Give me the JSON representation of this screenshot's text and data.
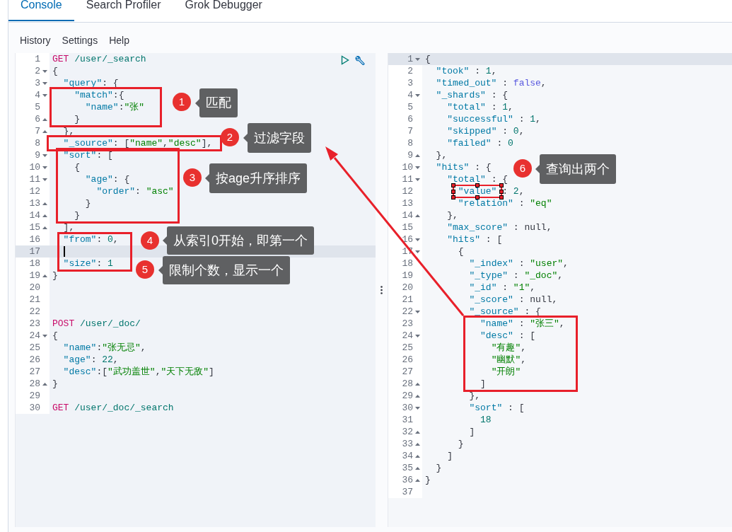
{
  "tabs": [
    {
      "label": "Console",
      "selected": true
    },
    {
      "label": "Search Profiler",
      "selected": false
    },
    {
      "label": "Grok Debugger",
      "selected": false
    }
  ],
  "menu": [
    "History",
    "Settings",
    "Help"
  ],
  "request_editor": {
    "caret_visible": true,
    "lines": [
      {
        "number": "1",
        "kind": "plain",
        "active": false,
        "tokens": [
          {
            "text": "GET",
            "kind": "method"
          },
          {
            "text": " /user/_search",
            "kind": "path"
          }
        ]
      },
      {
        "number": "2",
        "kind": "fold-start",
        "active": false,
        "tokens": [
          {
            "text": "{",
            "kind": "punct"
          }
        ]
      },
      {
        "number": "3",
        "kind": "fold-start",
        "active": false,
        "tokens": [
          {
            "text": "  \"query\"",
            "kind": "key"
          },
          {
            "text": ": {",
            "kind": "punct"
          }
        ]
      },
      {
        "number": "4",
        "kind": "fold-start",
        "active": false,
        "tokens": [
          {
            "text": "    \"match\"",
            "kind": "key"
          },
          {
            "text": ":{",
            "kind": "punct"
          }
        ]
      },
      {
        "number": "5",
        "kind": "plain",
        "active": false,
        "tokens": [
          {
            "text": "      \"name\"",
            "kind": "key"
          },
          {
            "text": ":",
            "kind": "punct"
          },
          {
            "text": "\"张\"",
            "kind": "string"
          }
        ]
      },
      {
        "number": "6",
        "kind": "fold-end",
        "active": false,
        "tokens": [
          {
            "text": "    }",
            "kind": "punct"
          }
        ]
      },
      {
        "number": "7",
        "kind": "fold-end",
        "active": false,
        "tokens": [
          {
            "text": "  },",
            "kind": "punct"
          }
        ]
      },
      {
        "number": "8",
        "kind": "plain",
        "active": false,
        "tokens": [
          {
            "text": "  \"_source\"",
            "kind": "key"
          },
          {
            "text": ": [",
            "kind": "punct"
          },
          {
            "text": "\"name\"",
            "kind": "string"
          },
          {
            "text": ",",
            "kind": "punct"
          },
          {
            "text": "\"desc\"",
            "kind": "string"
          },
          {
            "text": "],",
            "kind": "punct"
          }
        ]
      },
      {
        "number": "9",
        "kind": "fold-start",
        "active": false,
        "tokens": [
          {
            "text": "  \"sort\"",
            "kind": "key"
          },
          {
            "text": ": [",
            "kind": "punct"
          }
        ]
      },
      {
        "number": "10",
        "kind": "fold-start",
        "active": false,
        "tokens": [
          {
            "text": "    {",
            "kind": "punct"
          }
        ]
      },
      {
        "number": "11",
        "kind": "fold-start",
        "active": false,
        "tokens": [
          {
            "text": "      \"age\"",
            "kind": "key"
          },
          {
            "text": ": {",
            "kind": "punct"
          }
        ]
      },
      {
        "number": "12",
        "kind": "plain",
        "active": false,
        "tokens": [
          {
            "text": "        \"order\"",
            "kind": "key"
          },
          {
            "text": ": ",
            "kind": "punct"
          },
          {
            "text": "\"asc\"",
            "kind": "string"
          }
        ]
      },
      {
        "number": "13",
        "kind": "fold-end",
        "active": false,
        "tokens": [
          {
            "text": "      }",
            "kind": "punct"
          }
        ]
      },
      {
        "number": "14",
        "kind": "fold-end",
        "active": false,
        "tokens": [
          {
            "text": "    }",
            "kind": "punct"
          }
        ]
      },
      {
        "number": "15",
        "kind": "fold-end",
        "active": false,
        "tokens": [
          {
            "text": "  ],",
            "kind": "punct"
          }
        ]
      },
      {
        "number": "16",
        "kind": "plain",
        "active": false,
        "tokens": [
          {
            "text": "  \"from\"",
            "kind": "key"
          },
          {
            "text": ": ",
            "kind": "punct"
          },
          {
            "text": "0",
            "kind": "number"
          },
          {
            "text": ",",
            "kind": "punct"
          }
        ]
      },
      {
        "number": "17",
        "kind": "plain",
        "active": true
      },
      {
        "number": "18",
        "kind": "plain",
        "active": false,
        "tokens": [
          {
            "text": "  \"size\"",
            "kind": "key"
          },
          {
            "text": ": ",
            "kind": "punct"
          },
          {
            "text": "1",
            "kind": "number"
          }
        ]
      },
      {
        "number": "19",
        "kind": "fold-end",
        "active": false,
        "tokens": [
          {
            "text": "}",
            "kind": "punct"
          }
        ]
      },
      {
        "number": "20",
        "kind": "plain",
        "active": false
      },
      {
        "number": "21",
        "kind": "plain",
        "active": false
      },
      {
        "number": "22",
        "kind": "plain",
        "active": false
      },
      {
        "number": "23",
        "kind": "plain",
        "active": false,
        "tokens": [
          {
            "text": "POST",
            "kind": "method"
          },
          {
            "text": " /user/_doc/",
            "kind": "path"
          }
        ]
      },
      {
        "number": "24",
        "kind": "fold-start",
        "active": false,
        "tokens": [
          {
            "text": "{",
            "kind": "punct"
          }
        ]
      },
      {
        "number": "25",
        "kind": "plain",
        "active": false,
        "tokens": [
          {
            "text": "  \"name\"",
            "kind": "key"
          },
          {
            "text": ":",
            "kind": "punct"
          },
          {
            "text": "\"张无忌\"",
            "kind": "string"
          },
          {
            "text": ",",
            "kind": "punct"
          }
        ]
      },
      {
        "number": "26",
        "kind": "plain",
        "active": false,
        "tokens": [
          {
            "text": "  \"age\"",
            "kind": "key"
          },
          {
            "text": ": ",
            "kind": "punct"
          },
          {
            "text": "22",
            "kind": "number"
          },
          {
            "text": ",",
            "kind": "punct"
          }
        ]
      },
      {
        "number": "27",
        "kind": "plain",
        "active": false,
        "tokens": [
          {
            "text": "  \"desc\"",
            "kind": "key"
          },
          {
            "text": ":[",
            "kind": "punct"
          },
          {
            "text": "\"武功盖世\"",
            "kind": "string"
          },
          {
            "text": ",",
            "kind": "punct"
          },
          {
            "text": "\"天下无敌\"",
            "kind": "string"
          },
          {
            "text": "]",
            "kind": "punct"
          }
        ]
      },
      {
        "number": "28",
        "kind": "fold-end",
        "active": false,
        "tokens": [
          {
            "text": "}",
            "kind": "punct"
          }
        ]
      },
      {
        "number": "29",
        "kind": "plain",
        "active": false
      },
      {
        "number": "30",
        "kind": "plain",
        "active": false,
        "tokens": [
          {
            "text": "GET",
            "kind": "method"
          },
          {
            "text": " /user/_doc/_search",
            "kind": "path"
          }
        ]
      }
    ]
  },
  "response_editor": {
    "lines": [
      {
        "number": "1",
        "kind": "fold-start",
        "active": true,
        "tokens": [
          {
            "text": "{",
            "kind": "punct"
          }
        ]
      },
      {
        "number": "2",
        "kind": "plain",
        "active": false,
        "tokens": [
          {
            "text": "  \"took\"",
            "kind": "key"
          },
          {
            "text": " : ",
            "kind": "punct"
          },
          {
            "text": "1",
            "kind": "number"
          },
          {
            "text": ",",
            "kind": "punct"
          }
        ]
      },
      {
        "number": "3",
        "kind": "plain",
        "active": false,
        "tokens": [
          {
            "text": "  \"timed_out\"",
            "kind": "key"
          },
          {
            "text": " : ",
            "kind": "punct"
          },
          {
            "text": "false",
            "kind": "literal"
          },
          {
            "text": ",",
            "kind": "punct"
          }
        ]
      },
      {
        "number": "4",
        "kind": "fold-start",
        "active": false,
        "tokens": [
          {
            "text": "  \"_shards\"",
            "kind": "key"
          },
          {
            "text": " : {",
            "kind": "punct"
          }
        ]
      },
      {
        "number": "5",
        "kind": "plain",
        "active": false,
        "tokens": [
          {
            "text": "    \"total\"",
            "kind": "key"
          },
          {
            "text": " : ",
            "kind": "punct"
          },
          {
            "text": "1",
            "kind": "number"
          },
          {
            "text": ",",
            "kind": "punct"
          }
        ]
      },
      {
        "number": "6",
        "kind": "plain",
        "active": false,
        "tokens": [
          {
            "text": "    \"successful\"",
            "kind": "key"
          },
          {
            "text": " : ",
            "kind": "punct"
          },
          {
            "text": "1",
            "kind": "number"
          },
          {
            "text": ",",
            "kind": "punct"
          }
        ]
      },
      {
        "number": "7",
        "kind": "plain",
        "active": false,
        "tokens": [
          {
            "text": "    \"skipped\"",
            "kind": "key"
          },
          {
            "text": " : ",
            "kind": "punct"
          },
          {
            "text": "0",
            "kind": "number"
          },
          {
            "text": ",",
            "kind": "punct"
          }
        ]
      },
      {
        "number": "8",
        "kind": "plain",
        "active": false,
        "tokens": [
          {
            "text": "    \"failed\"",
            "kind": "key"
          },
          {
            "text": " : ",
            "kind": "punct"
          },
          {
            "text": "0",
            "kind": "number"
          }
        ]
      },
      {
        "number": "9",
        "kind": "fold-end",
        "active": false,
        "tokens": [
          {
            "text": "  },",
            "kind": "punct"
          }
        ]
      },
      {
        "number": "10",
        "kind": "fold-start",
        "active": false,
        "tokens": [
          {
            "text": "  \"hits\"",
            "kind": "key"
          },
          {
            "text": " : {",
            "kind": "punct"
          }
        ]
      },
      {
        "number": "11",
        "kind": "fold-start",
        "active": false,
        "tokens": [
          {
            "text": "    \"total\"",
            "kind": "key"
          },
          {
            "text": " : {",
            "kind": "punct"
          }
        ]
      },
      {
        "number": "12",
        "kind": "plain",
        "active": false,
        "tokens": [
          {
            "text": "      \"value\"",
            "kind": "key"
          },
          {
            "text": " : ",
            "kind": "punct"
          },
          {
            "text": "2",
            "kind": "number"
          },
          {
            "text": ",",
            "kind": "punct"
          }
        ]
      },
      {
        "number": "13",
        "kind": "plain",
        "active": false,
        "tokens": [
          {
            "text": "      \"relation\"",
            "kind": "key"
          },
          {
            "text": " : ",
            "kind": "punct"
          },
          {
            "text": "\"eq\"",
            "kind": "string"
          }
        ]
      },
      {
        "number": "14",
        "kind": "fold-end",
        "active": false,
        "tokens": [
          {
            "text": "    },",
            "kind": "punct"
          }
        ]
      },
      {
        "number": "15",
        "kind": "plain",
        "active": false,
        "tokens": [
          {
            "text": "    \"max_score\"",
            "kind": "key"
          },
          {
            "text": " : null,",
            "kind": "punct"
          }
        ]
      },
      {
        "number": "16",
        "kind": "fold-start",
        "active": false,
        "tokens": [
          {
            "text": "    \"hits\"",
            "kind": "key"
          },
          {
            "text": " : [",
            "kind": "punct"
          }
        ]
      },
      {
        "number": "17",
        "kind": "fold-start",
        "active": false,
        "tokens": [
          {
            "text": "      {",
            "kind": "punct"
          }
        ]
      },
      {
        "number": "18",
        "kind": "plain",
        "active": false,
        "tokens": [
          {
            "text": "        \"_index\"",
            "kind": "key"
          },
          {
            "text": " : ",
            "kind": "punct"
          },
          {
            "text": "\"user\"",
            "kind": "string"
          },
          {
            "text": ",",
            "kind": "punct"
          }
        ]
      },
      {
        "number": "19",
        "kind": "plain",
        "active": false,
        "tokens": [
          {
            "text": "        \"_type\"",
            "kind": "key"
          },
          {
            "text": " : ",
            "kind": "punct"
          },
          {
            "text": "\"_doc\"",
            "kind": "string"
          },
          {
            "text": ",",
            "kind": "punct"
          }
        ]
      },
      {
        "number": "20",
        "kind": "plain",
        "active": false,
        "tokens": [
          {
            "text": "        \"_id\"",
            "kind": "key"
          },
          {
            "text": " : ",
            "kind": "punct"
          },
          {
            "text": "\"1\"",
            "kind": "string"
          },
          {
            "text": ",",
            "kind": "punct"
          }
        ]
      },
      {
        "number": "21",
        "kind": "plain",
        "active": false,
        "tokens": [
          {
            "text": "        \"_score\"",
            "kind": "key"
          },
          {
            "text": " : null,",
            "kind": "punct"
          }
        ]
      },
      {
        "number": "22",
        "kind": "fold-start",
        "active": false,
        "tokens": [
          {
            "text": "        \"_source\"",
            "kind": "key"
          },
          {
            "text": " : {",
            "kind": "punct"
          }
        ]
      },
      {
        "number": "23",
        "kind": "plain",
        "active": false,
        "tokens": [
          {
            "text": "          \"name\"",
            "kind": "key"
          },
          {
            "text": " : ",
            "kind": "punct"
          },
          {
            "text": "\"张三\"",
            "kind": "string"
          },
          {
            "text": ",",
            "kind": "punct"
          }
        ]
      },
      {
        "number": "24",
        "kind": "fold-start",
        "active": false,
        "tokens": [
          {
            "text": "          \"desc\"",
            "kind": "key"
          },
          {
            "text": " : [",
            "kind": "punct"
          }
        ]
      },
      {
        "number": "25",
        "kind": "plain",
        "active": false,
        "tokens": [
          {
            "text": "            \"有趣\"",
            "kind": "string"
          },
          {
            "text": ",",
            "kind": "punct"
          }
        ]
      },
      {
        "number": "26",
        "kind": "plain",
        "active": false,
        "tokens": [
          {
            "text": "            \"幽默\"",
            "kind": "string"
          },
          {
            "text": ",",
            "kind": "punct"
          }
        ]
      },
      {
        "number": "27",
        "kind": "plain",
        "active": false,
        "tokens": [
          {
            "text": "            \"开朗\"",
            "kind": "string"
          }
        ]
      },
      {
        "number": "28",
        "kind": "fold-end",
        "active": false,
        "tokens": [
          {
            "text": "          ]",
            "kind": "punct"
          }
        ]
      },
      {
        "number": "29",
        "kind": "fold-end",
        "active": false,
        "tokens": [
          {
            "text": "        },",
            "kind": "punct"
          }
        ]
      },
      {
        "number": "30",
        "kind": "fold-start",
        "active": false,
        "tokens": [
          {
            "text": "        \"sort\"",
            "kind": "key"
          },
          {
            "text": " : [",
            "kind": "punct"
          }
        ]
      },
      {
        "number": "31",
        "kind": "plain",
        "active": false,
        "tokens": [
          {
            "text": "          18",
            "kind": "number"
          }
        ]
      },
      {
        "number": "32",
        "kind": "fold-end",
        "active": false,
        "tokens": [
          {
            "text": "        ]",
            "kind": "punct"
          }
        ]
      },
      {
        "number": "33",
        "kind": "fold-end",
        "active": false,
        "tokens": [
          {
            "text": "      }",
            "kind": "punct"
          }
        ]
      },
      {
        "number": "34",
        "kind": "fold-end",
        "active": false,
        "tokens": [
          {
            "text": "    ]",
            "kind": "punct"
          }
        ]
      },
      {
        "number": "35",
        "kind": "fold-end",
        "active": false,
        "tokens": [
          {
            "text": "  }",
            "kind": "punct"
          }
        ]
      },
      {
        "number": "36",
        "kind": "fold-end",
        "active": false,
        "tokens": [
          {
            "text": "}",
            "kind": "punct"
          }
        ]
      },
      {
        "number": "37",
        "kind": "plain",
        "active": false
      }
    ]
  },
  "annotations": [
    {
      "number": "1",
      "label": "匹配"
    },
    {
      "number": "2",
      "label": "过滤字段"
    },
    {
      "number": "3",
      "label": "按age升序排序"
    },
    {
      "number": "4",
      "label": "从索引0开始，即第一个"
    },
    {
      "number": "5",
      "label": "限制个数，显示一个"
    },
    {
      "number": "6",
      "label": "查询出两个"
    }
  ]
}
